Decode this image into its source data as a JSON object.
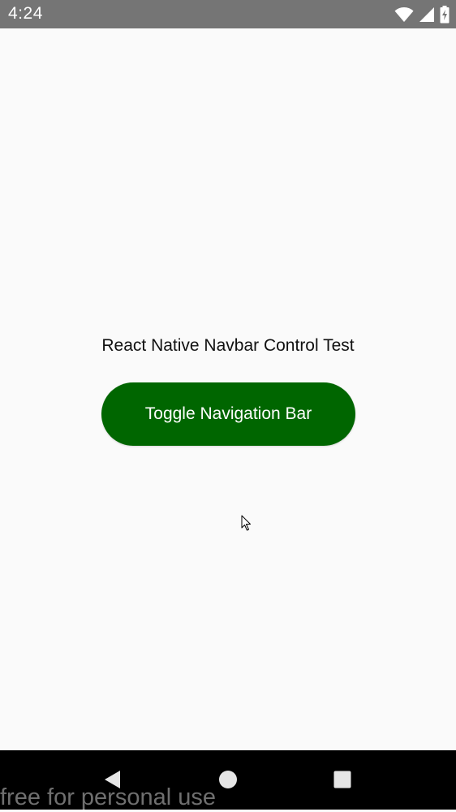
{
  "status_bar": {
    "time": "4:24",
    "background_color": "#757575",
    "icons": [
      "wifi-icon",
      "signal-icon",
      "battery-charging-icon"
    ]
  },
  "main": {
    "title": "React Native Navbar Control Test",
    "toggle_button_label": "Toggle Navigation Bar",
    "button_color": "#006600",
    "background_color": "#fafafa"
  },
  "nav_bar": {
    "background_color": "#000000",
    "buttons": [
      "back-icon",
      "home-icon",
      "recents-icon"
    ]
  },
  "watermark": {
    "text": "free for personal use"
  }
}
